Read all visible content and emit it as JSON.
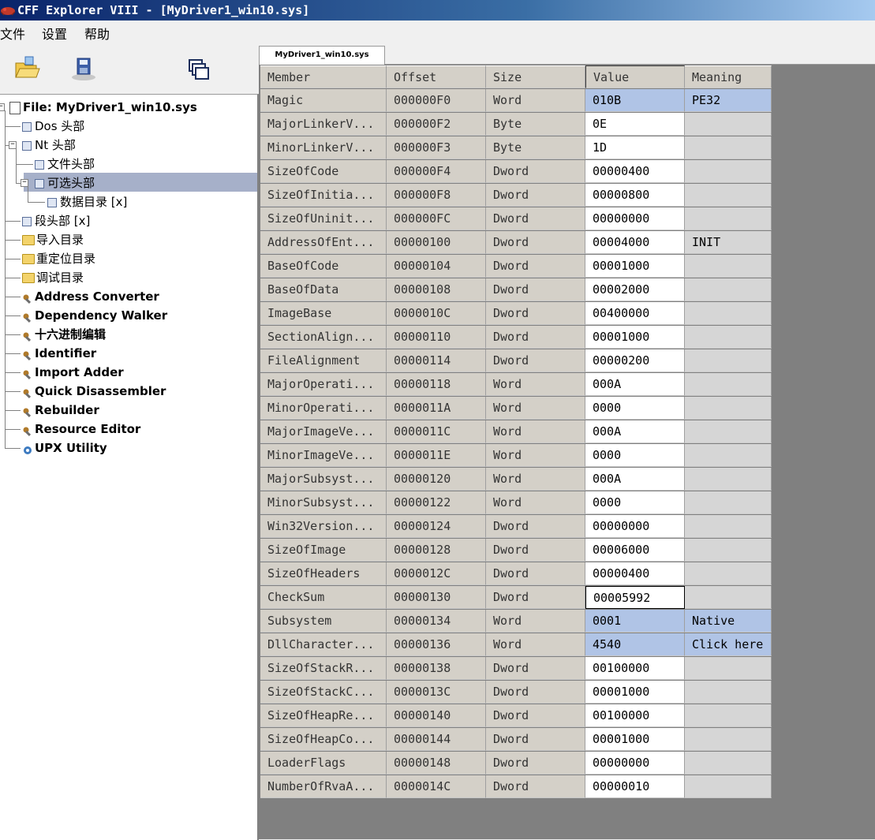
{
  "window": {
    "title": "CFF Explorer VIII - [MyDriver1_win10.sys]"
  },
  "menu": {
    "items": [
      "文件",
      "设置",
      "帮助"
    ]
  },
  "toolbar": {
    "buttons": [
      "open-folder-icon",
      "save-disk-icon",
      "windows-cascade-icon"
    ]
  },
  "tree": {
    "root": "File: MyDriver1_win10.sys",
    "dos": "Dos 头部",
    "nt": "Nt 头部",
    "file_header": "文件头部",
    "optional_header": "可选头部",
    "data_dir": "数据目录 [x]",
    "section": "段头部 [x]",
    "import_dir": "导入目录",
    "reloc_dir": "重定位目录",
    "debug_dir": "调试目录",
    "tools": [
      "Address Converter",
      "Dependency Walker",
      "十六进制编辑",
      "Identifier",
      "Import Adder",
      "Quick Disassembler",
      "Rebuilder",
      "Resource Editor",
      "UPX Utility"
    ]
  },
  "tab": {
    "label": "MyDriver1_win10.sys"
  },
  "grid": {
    "headers": [
      "Member",
      "Offset",
      "Size",
      "Value",
      "Meaning"
    ],
    "rows": [
      [
        "Magic",
        "000000F0",
        "Word",
        "010B",
        "PE32"
      ],
      [
        "MajorLinkerV...",
        "000000F2",
        "Byte",
        "0E",
        ""
      ],
      [
        "MinorLinkerV...",
        "000000F3",
        "Byte",
        "1D",
        ""
      ],
      [
        "SizeOfCode",
        "000000F4",
        "Dword",
        "00000400",
        ""
      ],
      [
        "SizeOfInitia...",
        "000000F8",
        "Dword",
        "00000800",
        ""
      ],
      [
        "SizeOfUninit...",
        "000000FC",
        "Dword",
        "00000000",
        ""
      ],
      [
        "AddressOfEnt...",
        "00000100",
        "Dword",
        "00004000",
        "INIT"
      ],
      [
        "BaseOfCode",
        "00000104",
        "Dword",
        "00001000",
        ""
      ],
      [
        "BaseOfData",
        "00000108",
        "Dword",
        "00002000",
        ""
      ],
      [
        "ImageBase",
        "0000010C",
        "Dword",
        "00400000",
        ""
      ],
      [
        "SectionAlign...",
        "00000110",
        "Dword",
        "00001000",
        ""
      ],
      [
        "FileAlignment",
        "00000114",
        "Dword",
        "00000200",
        ""
      ],
      [
        "MajorOperati...",
        "00000118",
        "Word",
        "000A",
        ""
      ],
      [
        "MinorOperati...",
        "0000011A",
        "Word",
        "0000",
        ""
      ],
      [
        "MajorImageVe...",
        "0000011C",
        "Word",
        "000A",
        ""
      ],
      [
        "MinorImageVe...",
        "0000011E",
        "Word",
        "0000",
        ""
      ],
      [
        "MajorSubsyst...",
        "00000120",
        "Word",
        "000A",
        ""
      ],
      [
        "MinorSubsyst...",
        "00000122",
        "Word",
        "0000",
        ""
      ],
      [
        "Win32Version...",
        "00000124",
        "Dword",
        "00000000",
        ""
      ],
      [
        "SizeOfImage",
        "00000128",
        "Dword",
        "00006000",
        ""
      ],
      [
        "SizeOfHeaders",
        "0000012C",
        "Dword",
        "00000400",
        ""
      ],
      [
        "CheckSum",
        "00000130",
        "Dword",
        "00005992",
        ""
      ],
      [
        "Subsystem",
        "00000134",
        "Word",
        "0001",
        "Native"
      ],
      [
        "DllCharacter...",
        "00000136",
        "Word",
        "4540",
        "Click here"
      ],
      [
        "SizeOfStackR...",
        "00000138",
        "Dword",
        "00100000",
        ""
      ],
      [
        "SizeOfStackC...",
        "0000013C",
        "Dword",
        "00001000",
        ""
      ],
      [
        "SizeOfHeapRe...",
        "00000140",
        "Dword",
        "00100000",
        ""
      ],
      [
        "SizeOfHeapCo...",
        "00000144",
        "Dword",
        "00001000",
        ""
      ],
      [
        "LoaderFlags",
        "00000148",
        "Dword",
        "00000000",
        ""
      ],
      [
        "NumberOfRvaA...",
        "0000014C",
        "Dword",
        "00000010",
        ""
      ]
    ],
    "selected_rows": [
      0,
      22,
      23
    ],
    "editing_row": 21
  },
  "colors": {
    "selection": "#b0c4e6",
    "tree_selection": "#a6b0c9",
    "title_gradient_start": "#0a246a"
  }
}
